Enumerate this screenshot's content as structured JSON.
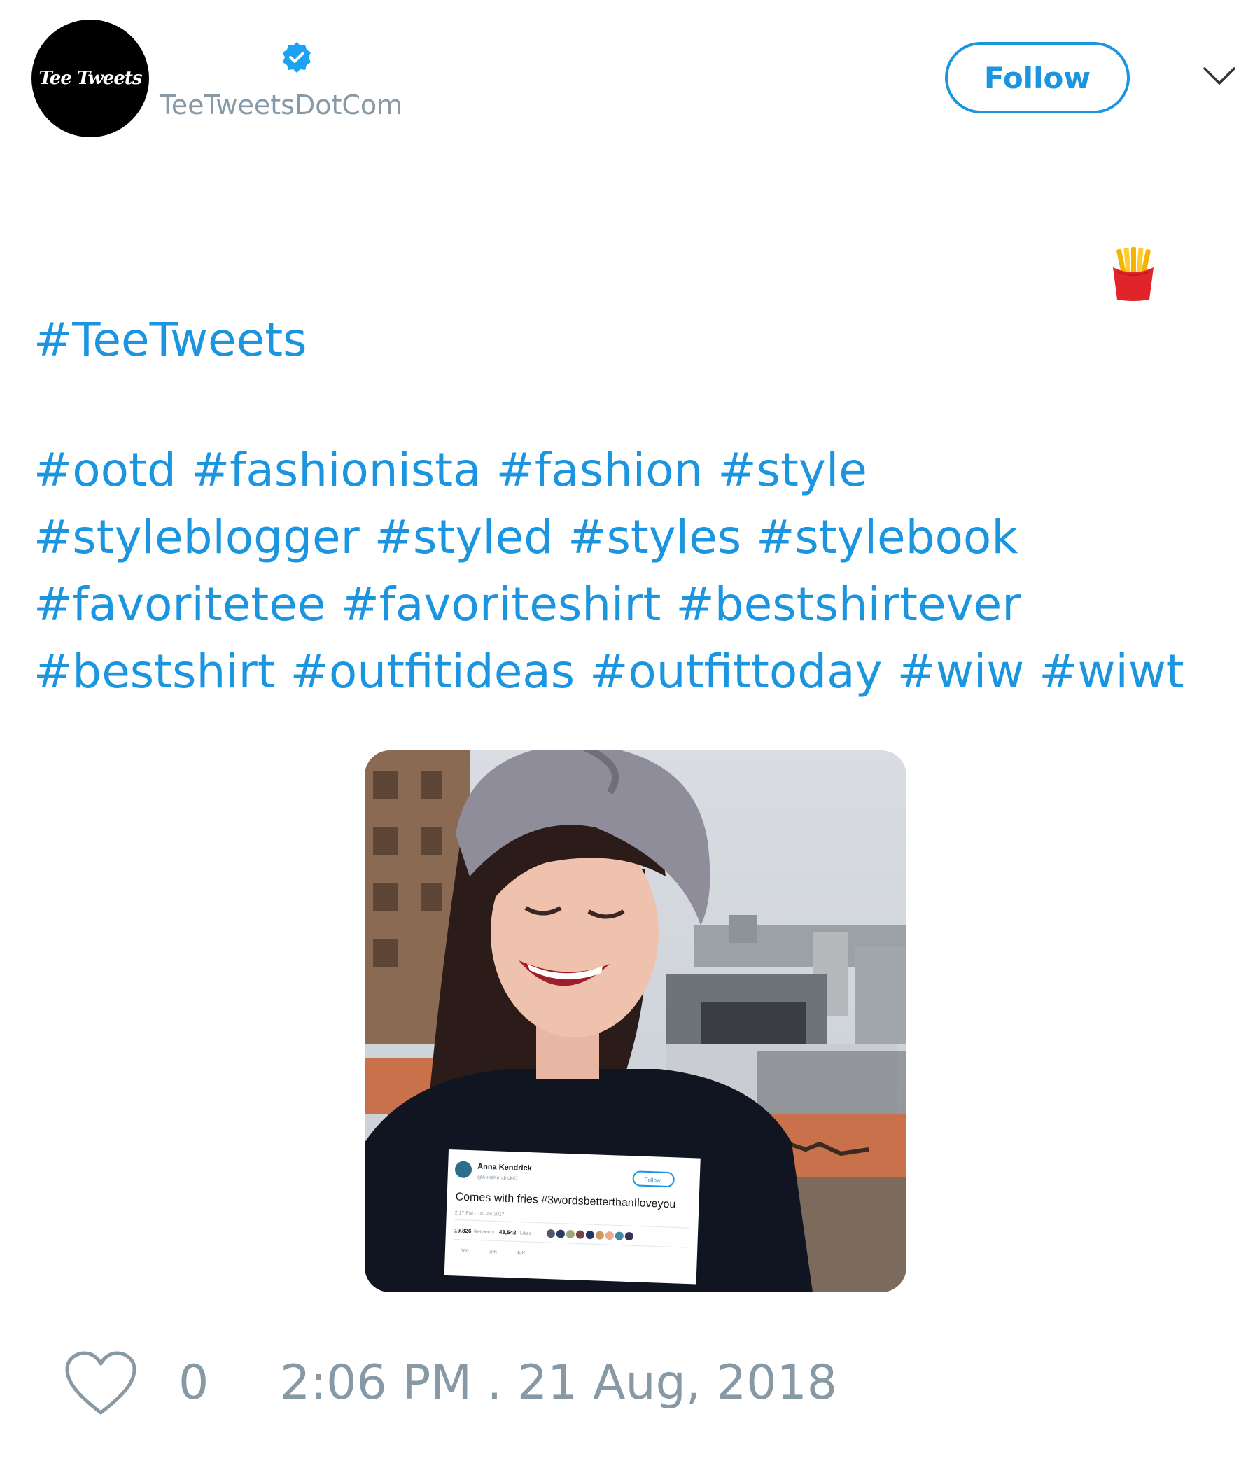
{
  "user": {
    "avatar_text": "Tee Tweets",
    "handle": "TeeTweetsDotCom",
    "verified": true
  },
  "follow_label": "Follow",
  "tweet": {
    "hashtag_line1": "#TeeTweets",
    "hashtags": [
      "#ootd",
      "#fashionista",
      "#fashion",
      "#style",
      "#styleblogger",
      "#styled",
      "#styles",
      "#stylebook",
      "#favoritetee",
      "#favoriteshirt",
      "#bestshirtever",
      "#bestshirt",
      "#outfitideas",
      "#outfittoday",
      "#wiw",
      "#wiwt"
    ]
  },
  "shirt": {
    "name": "Anna Kendrick",
    "handle": "@AnnaKendrick47",
    "follow": "Follow",
    "text": "Comes with fries #3wordsbetterthanIloveyou",
    "time": "2:17 PM - 18 Jan 2017",
    "retweets": "19,826",
    "retweets_label": "Retweets",
    "likes": "43,542",
    "likes_label": "Likes",
    "replies_count": "560",
    "retweet_count": "20K",
    "like_count": "44K"
  },
  "footer": {
    "like_count": "0",
    "timestamp": "2:06 PM . 21 Aug, 2018"
  },
  "colors": {
    "accent": "#1b95e0",
    "muted": "#8899a6"
  },
  "icons": [
    "verified-badge-icon",
    "chevron-down-icon",
    "fries-emoji-icon",
    "heart-icon"
  ]
}
